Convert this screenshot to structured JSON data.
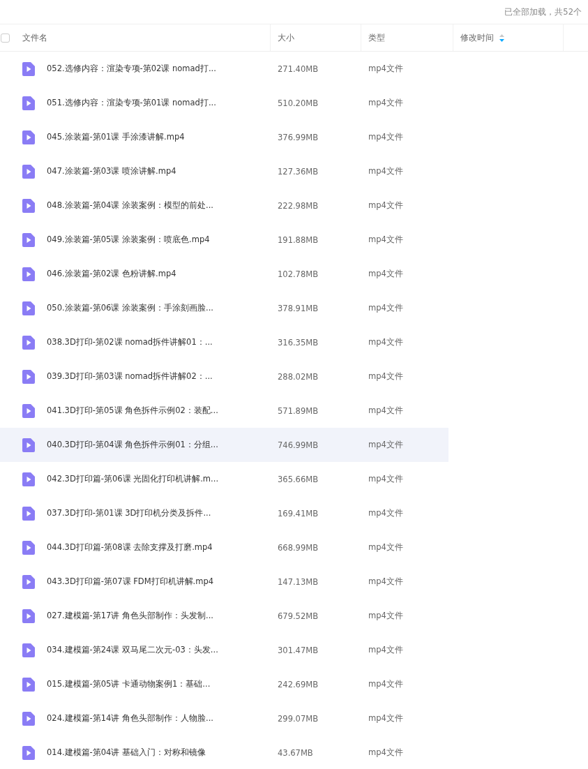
{
  "status": "已全部加载，共52个",
  "columns": [
    {
      "label": "文件名"
    },
    {
      "label": "大小"
    },
    {
      "label": "类型"
    },
    {
      "label": "修改时间",
      "sorted_descending": true
    }
  ],
  "select_all": {
    "checked": false
  },
  "rows": [
    {
      "name": "052.选修内容：渲染专项-第02课 nomad打...",
      "size": "271.40MB",
      "type": "mp4文件",
      "hovered": false
    },
    {
      "name": "051.选修内容：渲染专项-第01课 nomad打...",
      "size": "510.20MB",
      "type": "mp4文件",
      "hovered": false
    },
    {
      "name": "045.涂装篇-第01课 手涂漆讲解.mp4",
      "size": "376.99MB",
      "type": "mp4文件",
      "hovered": false
    },
    {
      "name": "047.涂装篇-第03课 喷涂讲解.mp4",
      "size": "127.36MB",
      "type": "mp4文件",
      "hovered": false
    },
    {
      "name": "048.涂装篇-第04课 涂装案例：模型的前处...",
      "size": "222.98MB",
      "type": "mp4文件",
      "hovered": false
    },
    {
      "name": "049.涂装篇-第05课 涂装案例：喷底色.mp4",
      "size": "191.88MB",
      "type": "mp4文件",
      "hovered": false
    },
    {
      "name": "046.涂装篇-第02课 色粉讲解.mp4",
      "size": "102.78MB",
      "type": "mp4文件",
      "hovered": false
    },
    {
      "name": "050.涂装篇-第06课 涂装案例：手涂刻画脸...",
      "size": "378.91MB",
      "type": "mp4文件",
      "hovered": false
    },
    {
      "name": "038.3D打印-第02课 nomad拆件讲解01：...",
      "size": "316.35MB",
      "type": "mp4文件",
      "hovered": false
    },
    {
      "name": "039.3D打印-第03课 nomad拆件讲解02：...",
      "size": "288.02MB",
      "type": "mp4文件",
      "hovered": false
    },
    {
      "name": "041.3D打印-第05课 角色拆件示例02：装配...",
      "size": "571.89MB",
      "type": "mp4文件",
      "hovered": false
    },
    {
      "name": "040.3D打印-第04课 角色拆件示例01：分组...",
      "size": "746.99MB",
      "type": "mp4文件",
      "hovered": true
    },
    {
      "name": "042.3D打印篇-第06课 光固化打印机讲解.m...",
      "size": "365.66MB",
      "type": "mp4文件",
      "hovered": false
    },
    {
      "name": "037.3D打印-第01课 3D打印机分类及拆件...",
      "size": "169.41MB",
      "type": "mp4文件",
      "hovered": false
    },
    {
      "name": "044.3D打印篇-第08课 去除支撑及打磨.mp4",
      "size": "668.99MB",
      "type": "mp4文件",
      "hovered": false
    },
    {
      "name": "043.3D打印篇-第07课 FDM打印机讲解.mp4",
      "size": "147.13MB",
      "type": "mp4文件",
      "hovered": false
    },
    {
      "name": "027.建模篇-第17讲 角色头部制作：头发制...",
      "size": "679.52MB",
      "type": "mp4文件",
      "hovered": false
    },
    {
      "name": "034.建模篇-第24课 双马尾二次元-03：头发...",
      "size": "301.47MB",
      "type": "mp4文件",
      "hovered": false
    },
    {
      "name": "015.建模篇-第05讲 卡通动物案例1：基础...",
      "size": "242.69MB",
      "type": "mp4文件",
      "hovered": false
    },
    {
      "name": "024.建模篇-第14讲 角色头部制作：人物脸...",
      "size": "299.07MB",
      "type": "mp4文件",
      "hovered": false
    },
    {
      "name": "014.建模篇-第04讲 基础入门：对称和镜像",
      "size": "43.67MB",
      "type": "mp4文件",
      "hovered": false
    }
  ]
}
